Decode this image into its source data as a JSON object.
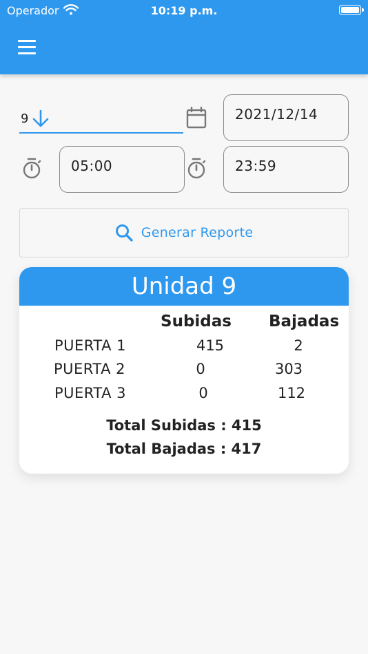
{
  "status_bar": {
    "carrier": "Operador",
    "time": "10:19 p.m."
  },
  "filters": {
    "unit_value": "9",
    "date_value": "2021/12/14",
    "start_time": "05:00",
    "end_time": "23:59"
  },
  "generate_button": {
    "label": "Generar Reporte"
  },
  "report": {
    "title": "Unidad 9",
    "columns": [
      "Subidas",
      "Bajadas"
    ],
    "rows": [
      {
        "door": "PUERTA 1",
        "subidas": "415",
        "bajadas": "2"
      },
      {
        "door": "PUERTA 2",
        "subidas": "0",
        "bajadas": "303"
      },
      {
        "door": "PUERTA 3",
        "subidas": "0",
        "bajadas": "112"
      }
    ],
    "total_subidas": "Total Subidas : 415",
    "total_bajadas": "Total Bajadas : 417"
  },
  "colors": {
    "accent": "#2e98ee",
    "background": "#f7f7f7",
    "text": "#222222"
  }
}
